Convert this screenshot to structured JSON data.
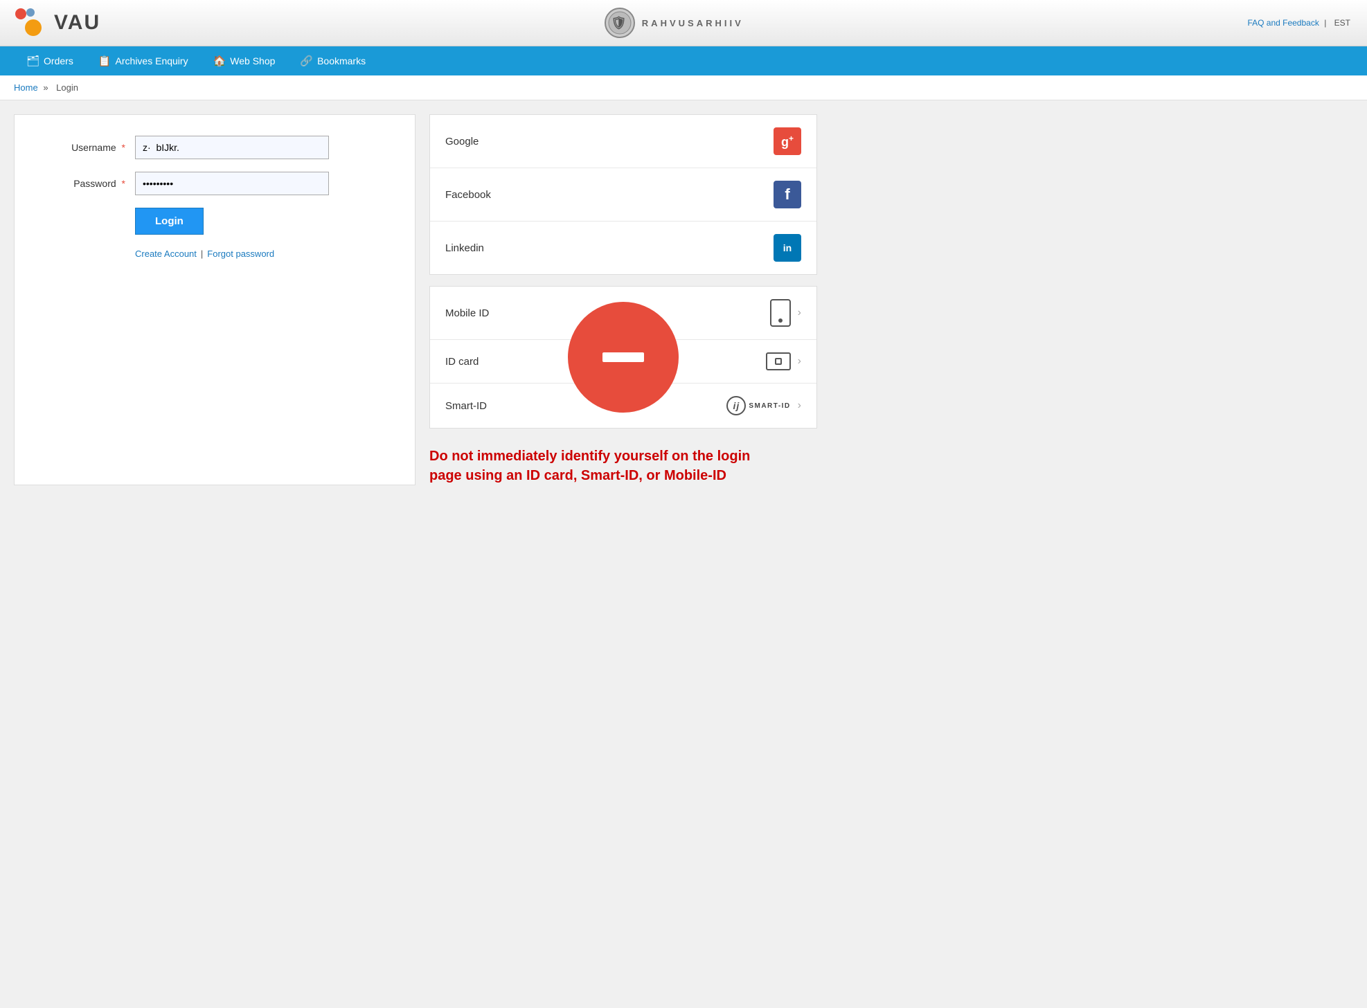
{
  "header": {
    "logo_text": "VAU",
    "center_text": "RAHVUSARHIIV",
    "faq_label": "FAQ and Feedback",
    "lang_label": "EST"
  },
  "navbar": {
    "items": [
      {
        "id": "orders",
        "icon": "🗂",
        "label": "Orders"
      },
      {
        "id": "archives",
        "icon": "📋",
        "label": "Archives Enquiry"
      },
      {
        "id": "webshop",
        "icon": "🏠",
        "label": "Web Shop"
      },
      {
        "id": "bookmarks",
        "icon": "🔗",
        "label": "Bookmarks"
      }
    ]
  },
  "breadcrumb": {
    "home": "Home",
    "separator": "»",
    "current": "Login"
  },
  "login_form": {
    "username_label": "Username",
    "username_value": "z·  bIJkr.",
    "password_label": "Password",
    "password_value": "••••••••",
    "required_mark": "*",
    "login_button": "Login",
    "create_account": "Create Account",
    "separator": "|",
    "forgot_password": "Forgot password"
  },
  "social_login": {
    "items": [
      {
        "id": "google",
        "label": "Google",
        "icon_text": "g+"
      },
      {
        "id": "facebook",
        "label": "Facebook",
        "icon_text": "f"
      },
      {
        "id": "linkedin",
        "label": "Linkedin",
        "icon_text": "in"
      }
    ]
  },
  "id_login": {
    "items": [
      {
        "id": "mobile-id",
        "label": "Mobile ID",
        "icon": "mobile"
      },
      {
        "id": "id-card",
        "label": "ID card",
        "icon": "idcard"
      },
      {
        "id": "smart-id",
        "label": "Smart-ID",
        "icon": "smartid"
      }
    ]
  },
  "warning": {
    "text": "Do not immediately identify yourself on the login page using an ID card, Smart-ID, or Mobile-ID"
  }
}
